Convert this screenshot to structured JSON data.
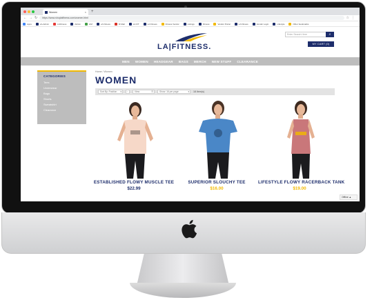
{
  "browser": {
    "tab_title": "Women",
    "url": "https://www.shoplafitness.com/women.html",
    "bookmarks": [
      "Apps",
      "LA-Admin",
      "LAFitness",
      "Admin",
      "LIM",
      "LA Fitness",
      "M Mail",
      "LA FIT",
      "LA Fitness",
      "Fitness Vendor",
      "Listings",
      "Fitness",
      "Vendor Portal",
      "LA Fitness",
      "Vendor Login",
      "Lifestyle",
      "Other bookmarks"
    ]
  },
  "header": {
    "logo_text": "LA|FITNESS.",
    "search_placeholder": "Enter Search Here",
    "search_icon": "search-icon",
    "cart_label": "MY CART (0)",
    "nav": [
      "MEN",
      "WOMEN",
      "HEADGEAR",
      "BAGS",
      "MERCH",
      "NEW STUFF",
      "CLEARANCE"
    ]
  },
  "sidebar": {
    "heading": "CATEGORIES",
    "items": [
      "Tees",
      "Underwear",
      "Bags",
      "Shorts",
      "Sweatshirt",
      "Clearance"
    ]
  },
  "main": {
    "breadcrumb": "Home / Women",
    "title": "WOMEN",
    "filters": {
      "sort_by": "Sort By: Position",
      "view": "View",
      "grid": "Show: 16 per page",
      "count": "18 Item(s)"
    },
    "products": [
      {
        "name": "ESTABLISHED FLOWY MUSCLE TEE",
        "price": "$22.99",
        "sale": false
      },
      {
        "name": "SUPERIOR SLOUCHY TEE",
        "price": "$16.00",
        "sale": true
      },
      {
        "name": "LIFESTYLE FLOWY RACERBACK TANK",
        "price": "$19.00",
        "sale": true
      }
    ]
  },
  "chat": {
    "label": "Offline ▲"
  },
  "colors": {
    "brand_navy": "#1d2d6b",
    "accent_gold": "#f2b900",
    "nav_gray": "#bdbdbd"
  }
}
